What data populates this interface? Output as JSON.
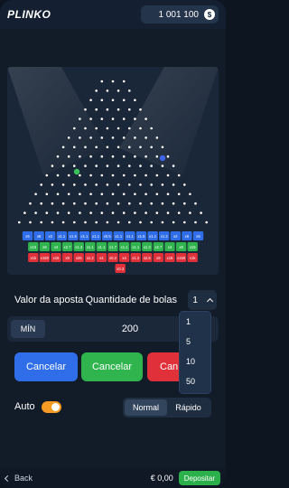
{
  "header": {
    "logo": "PLINKO",
    "balance": "1 001 100",
    "coin_symbol": "$"
  },
  "board": {
    "multipliers_rows": [
      [
        "x5",
        "x6",
        "x2",
        "x1.1",
        "x1.5",
        "x1.1",
        "x1.1",
        "x0.5",
        "x1.1",
        "x1.1",
        "x1.5",
        "x1.1",
        "x1.2",
        "x2",
        "x6",
        "x5"
      ],
      [
        "x15",
        "x8",
        "x4",
        "x2.7",
        "x1.3",
        "x1.1",
        "x1.1",
        "x1.7",
        "x1.1",
        "x1.1",
        "x1.3",
        "x2.7",
        "x4",
        "x8",
        "x15"
      ],
      [
        "x1k",
        "x150",
        "x16",
        "x9",
        "x25",
        "x1.2",
        "x4",
        "x0.2",
        "x4",
        "x1.2",
        "x2.5",
        "x9",
        "x16",
        "x150",
        "x1k"
      ]
    ],
    "multiplier_below": "x0.3",
    "colors": {
      "row1": "#2f6ee8",
      "row2": "#2fb44e",
      "row3": "#e0303a",
      "ball_green": "#3cc25a",
      "ball_blue": "#3f64e8"
    }
  },
  "bet": {
    "amount_label": "Valor da aposta",
    "quantity_label": "Quantidade de bolas",
    "quantity_value": "1",
    "min_label": "MÍN",
    "amount_value": "200",
    "buttons": [
      {
        "label": "Cancelar",
        "color": "#2f6ee8"
      },
      {
        "label": "Cancelar",
        "color": "#2fb44e"
      },
      {
        "label": "Can",
        "color": "#e0303a"
      }
    ],
    "auto_label": "Auto",
    "speed_normal": "Normal",
    "speed_fast": "Rápido"
  },
  "dropdown": {
    "options": [
      "1",
      "5",
      "10",
      "50"
    ]
  },
  "footer": {
    "back_label": "Back",
    "balance": "€ 0,00",
    "deposit_label": "Depositar"
  }
}
